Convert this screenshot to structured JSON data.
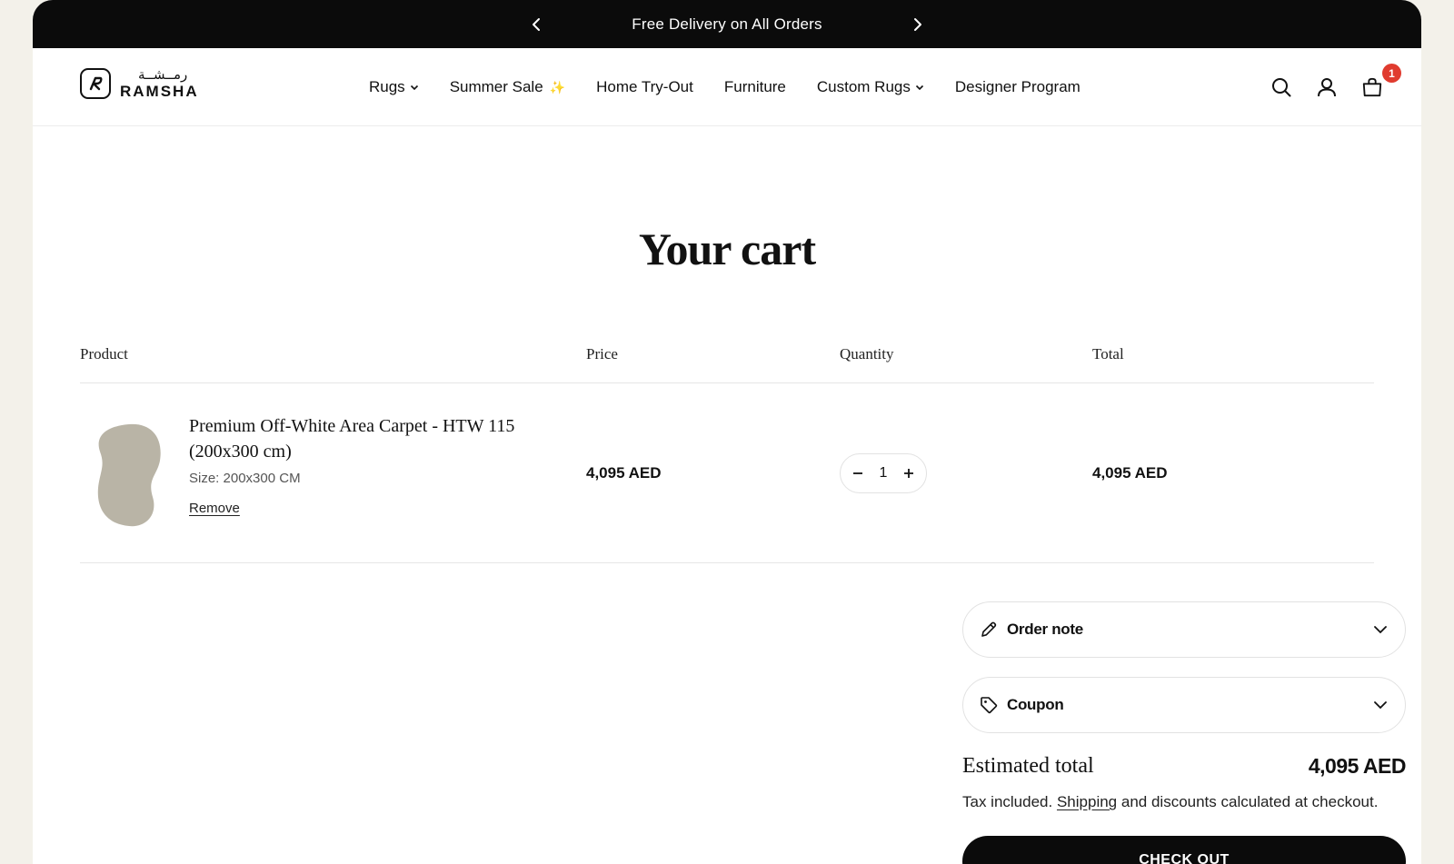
{
  "announcement": {
    "text": "Free Delivery on All Orders"
  },
  "brand": {
    "arabic": "رمــشــة",
    "latin": "RAMSHA"
  },
  "nav": {
    "items": [
      {
        "label": "Rugs",
        "dropdown": true
      },
      {
        "label": "Summer Sale",
        "dropdown": false,
        "sparkle": "✨"
      },
      {
        "label": "Home Try-Out",
        "dropdown": false
      },
      {
        "label": "Furniture",
        "dropdown": false
      },
      {
        "label": "Custom Rugs",
        "dropdown": true
      },
      {
        "label": "Designer Program",
        "dropdown": false
      }
    ]
  },
  "header_icons": [
    "search-icon",
    "account-icon",
    "cart-icon"
  ],
  "cart": {
    "title": "Your cart",
    "count_badge": "1",
    "columns": {
      "product": "Product",
      "price": "Price",
      "quantity": "Quantity",
      "total": "Total"
    },
    "items": [
      {
        "title": "Premium Off-White Area Carpet - HTW 115 (200x300 cm)",
        "variant": "Size: 200x300 CM",
        "remove_label": "Remove",
        "price": "4,095 AED",
        "quantity": "1",
        "total": "4,095 AED"
      }
    ]
  },
  "summary": {
    "order_note_label": "Order note",
    "coupon_label": "Coupon",
    "estimated_total_label": "Estimated total",
    "estimated_total_value": "4,095 AED",
    "tax_note_before": "Tax included.",
    "tax_note_link": "Shipping",
    "tax_note_after": "and discounts calculated at checkout.",
    "checkout_label": "CHECK OUT"
  },
  "colors": {
    "background": "#f3f1ea",
    "announcement_bar": "#0b0b0b",
    "badge": "#e03b2f",
    "checkout_button": "#0b0b0b",
    "rug_swatch": "#b9b4a6"
  }
}
